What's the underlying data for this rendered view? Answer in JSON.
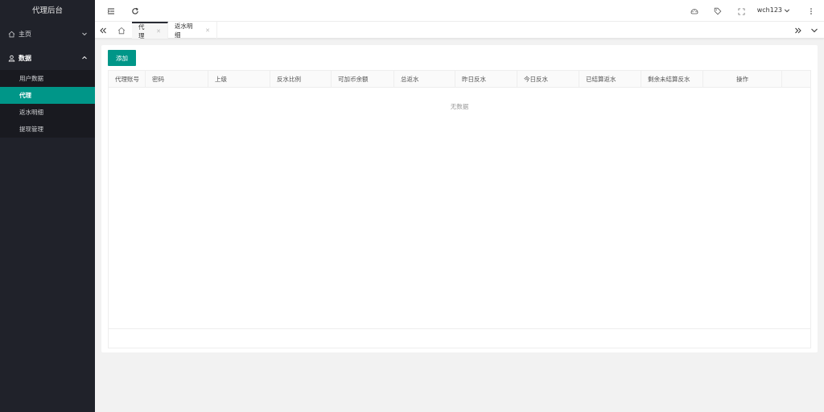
{
  "sidebar": {
    "logo": "代理后台",
    "menu": [
      {
        "label": "主页",
        "icon": "home-icon",
        "expanded": false
      },
      {
        "label": "数据",
        "icon": "user-icon",
        "expanded": true
      }
    ],
    "submenu": [
      {
        "label": "用户数据",
        "active": false
      },
      {
        "label": "代理",
        "active": true
      },
      {
        "label": "返水明细",
        "active": false
      },
      {
        "label": "提现管理",
        "active": false
      }
    ]
  },
  "header": {
    "username": "wch123"
  },
  "tabs": [
    {
      "label": "代理",
      "active": true
    },
    {
      "label": "返水明细",
      "active": false
    }
  ],
  "toolbar": {
    "add_label": "添加"
  },
  "table": {
    "columns": [
      "代理账号",
      "密码",
      "上级",
      "反水比例",
      "可加币余额",
      "总返水",
      "昨日反水",
      "今日反水",
      "已结算返水",
      "剩余未结算反水",
      "操作"
    ],
    "empty_text": "无数据"
  },
  "colors": {
    "sidebar_bg": "#20222a",
    "accent": "#009688"
  }
}
